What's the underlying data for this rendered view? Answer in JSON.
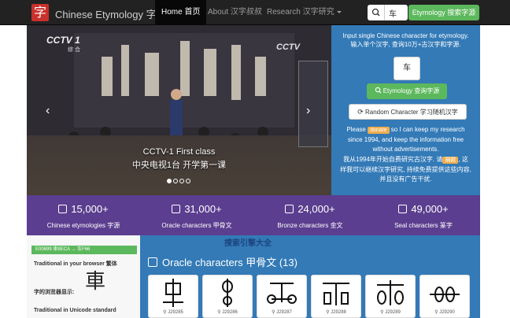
{
  "navbar": {
    "logo_char": "字",
    "brand": "Chinese Etymology 字源",
    "items": [
      {
        "label": "Home 首页"
      },
      {
        "label": "About 汉字叔叔"
      },
      {
        "label": "Research 汉字研究"
      }
    ],
    "search_value": "车",
    "search_button": "Etymology 搜索字源"
  },
  "carousel": {
    "caption_en": "CCTV-1 First class",
    "caption_zh": "中央电视1台 开学第一课",
    "prev": "‹",
    "next": "›",
    "logo_left": "CCTV 1",
    "logo_left_sub": "综 合",
    "logo_right": "CCTV"
  },
  "lookup": {
    "instruction_en": "Input single Chinese character for etymology.",
    "instruction_zh": "输入单个汉字, 查询10万+古汉字和字源.",
    "char_value": "车",
    "etym_button": "Etymology 查询字源",
    "random_button": "Random Character 学习随机汉字",
    "donate_pre": "Please",
    "donate_label": "donate",
    "donate_post": "so I can keep my research",
    "line2": "since 1994, and keep the information free",
    "line3": "without advertisements.",
    "zh1_pre": "我从1994年开始自费研究古汉字. 请",
    "zh1_badge": "捐款",
    "zh1_post": ", 这",
    "zh2": "样我可以继续汉字研究, 持续免费提供这些内容,",
    "zh3": "并且没有广告干扰."
  },
  "stats": [
    {
      "num": "15,000+",
      "label": "Chinese etymologies 字源"
    },
    {
      "num": "31,000+",
      "label": "Oracle characters 甲骨文"
    },
    {
      "num": "24,000+",
      "label": "Bronze characters 金文"
    },
    {
      "num": "49,000+",
      "label": "Seal characters 篆字"
    }
  ],
  "unicode_panel": {
    "badge": "E00699 車8ECA → 车F66",
    "traditional_browser": "Traditional in your browser 繁体",
    "browser_display": "字的浏览器显示:",
    "big_char": "車",
    "traditional_unicode": "Traditional in Unicode standard"
  },
  "oracle": {
    "title": "Oracle characters 甲骨文 (13)",
    "cards": [
      {
        "id": "J29285"
      },
      {
        "id": "J29286"
      },
      {
        "id": "J29287"
      },
      {
        "id": "J29288"
      },
      {
        "id": "J29289"
      },
      {
        "id": "J29290"
      }
    ]
  },
  "watermark": "搜索引擎大全"
}
